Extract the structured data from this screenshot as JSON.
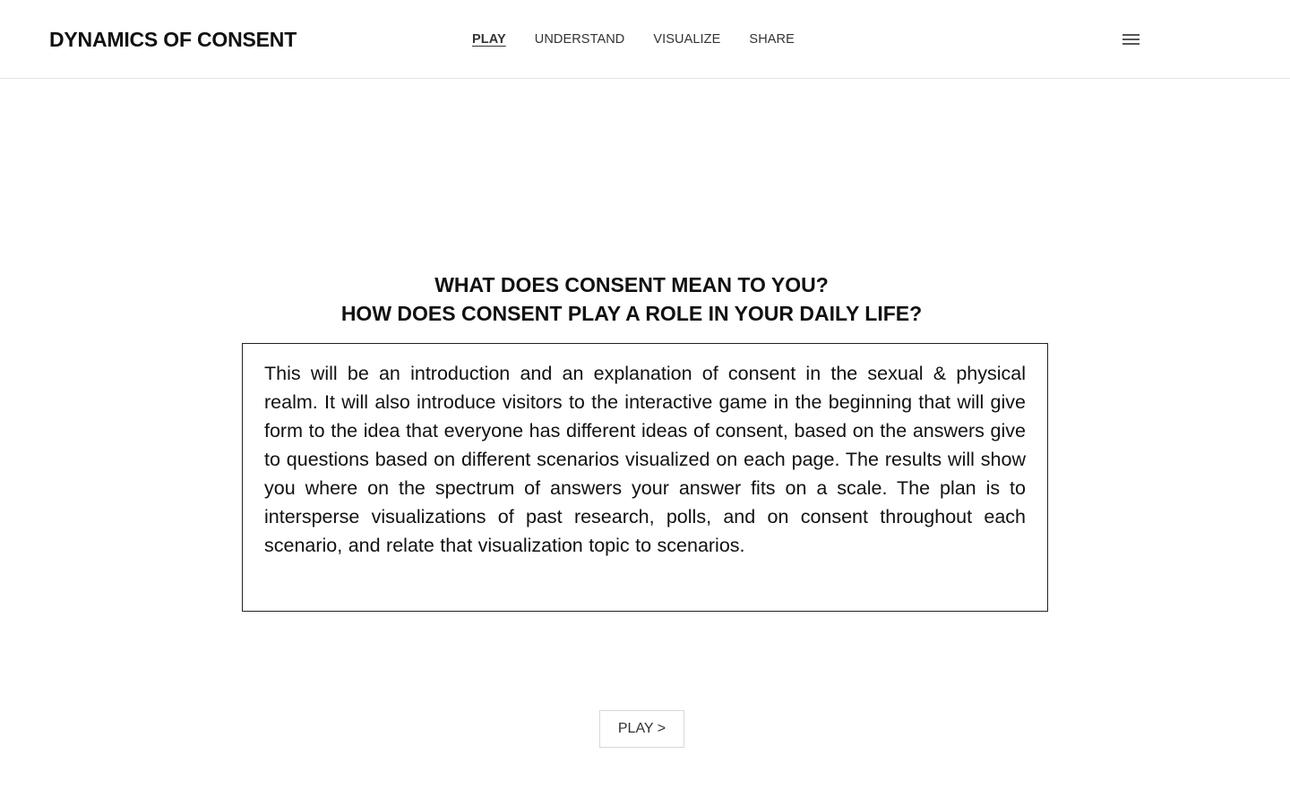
{
  "header": {
    "site_title": "DYNAMICS OF CONSENT",
    "nav": [
      {
        "label": "PLAY",
        "active": true
      },
      {
        "label": "UNDERSTAND",
        "active": false
      },
      {
        "label": "VISUALIZE",
        "active": false
      },
      {
        "label": "SHARE",
        "active": false
      }
    ],
    "menu_icon": "hamburger-menu-icon"
  },
  "main": {
    "headline_line1": "WHAT DOES CONSENT MEAN TO YOU?",
    "headline_line2": "HOW DOES CONSENT PLAY A ROLE IN YOUR DAILY LIFE?",
    "intro_text": "This will be an introduction and an explanation of consent in the sexual & physical realm. It will also introduce  visitors to the interactive game in the beginning that will give form to the idea that everyone has different ideas of consent, based on the answers give to questions based on different scenarios visualized on each page. The results will show you where on the spectrum of answers your answer fits on a scale. The plan is to intersperse visualizations of past research, polls, and on consent throughout each scenario, and relate that visualization topic to scenarios.",
    "play_button_label": "PLAY >"
  },
  "colors": {
    "text": "#111111",
    "nav_text": "#333333",
    "border": "#222222",
    "header_border": "#e4e4e4",
    "button_border": "#d8d8d8"
  }
}
